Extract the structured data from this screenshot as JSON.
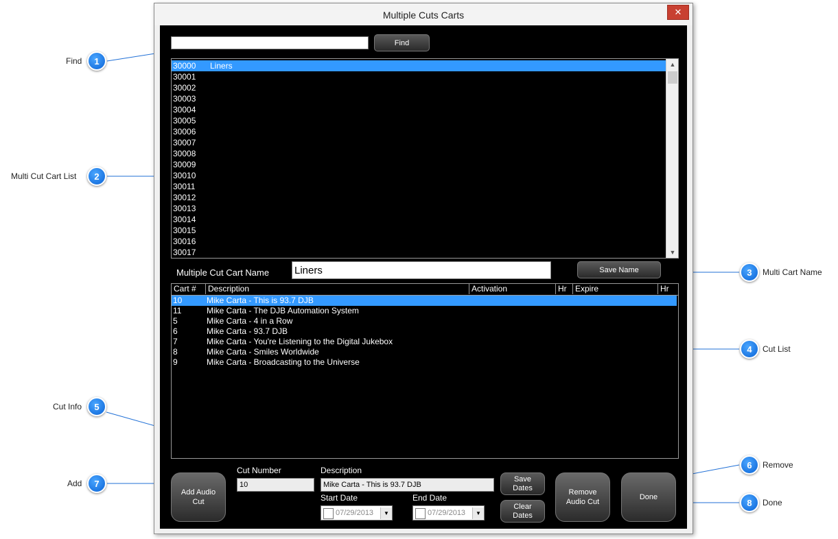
{
  "window": {
    "title": "Multiple Cuts Carts",
    "close_glyph": "✕"
  },
  "find": {
    "input_value": "",
    "button_label": "Find"
  },
  "cart_list": {
    "items": [
      {
        "number": "30000",
        "name": "Liners",
        "selected": true
      },
      {
        "number": "30001",
        "name": ""
      },
      {
        "number": "30002",
        "name": ""
      },
      {
        "number": "30003",
        "name": ""
      },
      {
        "number": "30004",
        "name": ""
      },
      {
        "number": "30005",
        "name": ""
      },
      {
        "number": "30006",
        "name": ""
      },
      {
        "number": "30007",
        "name": ""
      },
      {
        "number": "30008",
        "name": ""
      },
      {
        "number": "30009",
        "name": ""
      },
      {
        "number": "30010",
        "name": ""
      },
      {
        "number": "30011",
        "name": ""
      },
      {
        "number": "30012",
        "name": ""
      },
      {
        "number": "30013",
        "name": ""
      },
      {
        "number": "30014",
        "name": ""
      },
      {
        "number": "30015",
        "name": ""
      },
      {
        "number": "30016",
        "name": ""
      },
      {
        "number": "30017",
        "name": ""
      }
    ]
  },
  "name_section": {
    "label": "Multiple Cut Cart Name",
    "value": "Liners",
    "save_label": "Save Name"
  },
  "cut_list": {
    "headers": [
      "Cart #",
      "Description",
      "Activation",
      "Hr",
      "Expire",
      "Hr"
    ],
    "rows": [
      {
        "cart": "10",
        "description": "Mike Carta - This is 93.7 DJB",
        "selected": true
      },
      {
        "cart": "11",
        "description": "Mike Carta - The DJB Automation System"
      },
      {
        "cart": "5",
        "description": "Mike Carta - 4 in a Row"
      },
      {
        "cart": "6",
        "description": "Mike Carta - 93.7 DJB"
      },
      {
        "cart": "7",
        "description": "Mike Carta - You're Listening to the Digital Jukebox"
      },
      {
        "cart": "8",
        "description": "Mike Carta - Smiles Worldwide"
      },
      {
        "cart": "9",
        "description": "Mike Carta - Broadcasting to the Universe"
      }
    ]
  },
  "cut_info": {
    "cut_number_label": "Cut Number",
    "cut_number_value": "10",
    "description_label": "Description",
    "description_value": "Mike Carta - This is 93.7 DJB",
    "start_date_label": "Start Date",
    "start_date_value": "07/29/2013",
    "end_date_label": "End Date",
    "end_date_value": "07/29/2013",
    "save_dates_label": "Save Dates",
    "clear_dates_label": "Clear Dates"
  },
  "actions": {
    "add_label": "Add Audio Cut",
    "remove_label": "Remove Audio Cut",
    "done_label": "Done"
  },
  "callouts": [
    {
      "num": "1",
      "label": "Find"
    },
    {
      "num": "2",
      "label": "Multi Cut Cart List"
    },
    {
      "num": "3",
      "label": "Multi Cart Name"
    },
    {
      "num": "4",
      "label": "Cut List"
    },
    {
      "num": "5",
      "label": "Cut Info"
    },
    {
      "num": "6",
      "label": "Remove"
    },
    {
      "num": "7",
      "label": "Add"
    },
    {
      "num": "8",
      "label": "Done"
    }
  ]
}
